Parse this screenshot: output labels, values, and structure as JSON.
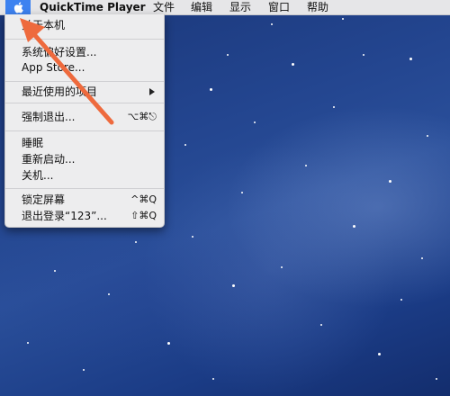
{
  "menubar": {
    "apple_icon": "apple-logo-icon",
    "app_name": "QuickTime Player",
    "menus": [
      "文件",
      "编辑",
      "显示",
      "窗口",
      "帮助"
    ]
  },
  "apple_menu": {
    "about": "关于本机",
    "system_prefs": "系统偏好设置...",
    "app_store": "App Store...",
    "recent_items": "最近使用的项目",
    "force_quit": "强制退出...",
    "force_quit_shortcut": "⌥⌘⎋",
    "sleep": "睡眠",
    "restart": "重新启动...",
    "shutdown": "关机...",
    "lock_screen": "锁定屏幕",
    "lock_screen_shortcut": "^⌘Q",
    "logout": "退出登录“123”...",
    "logout_shortcut": "⇧⌘Q"
  },
  "colors": {
    "annotation_arrow": "#ee6a3d",
    "apple_highlight": "#3d82f0"
  }
}
